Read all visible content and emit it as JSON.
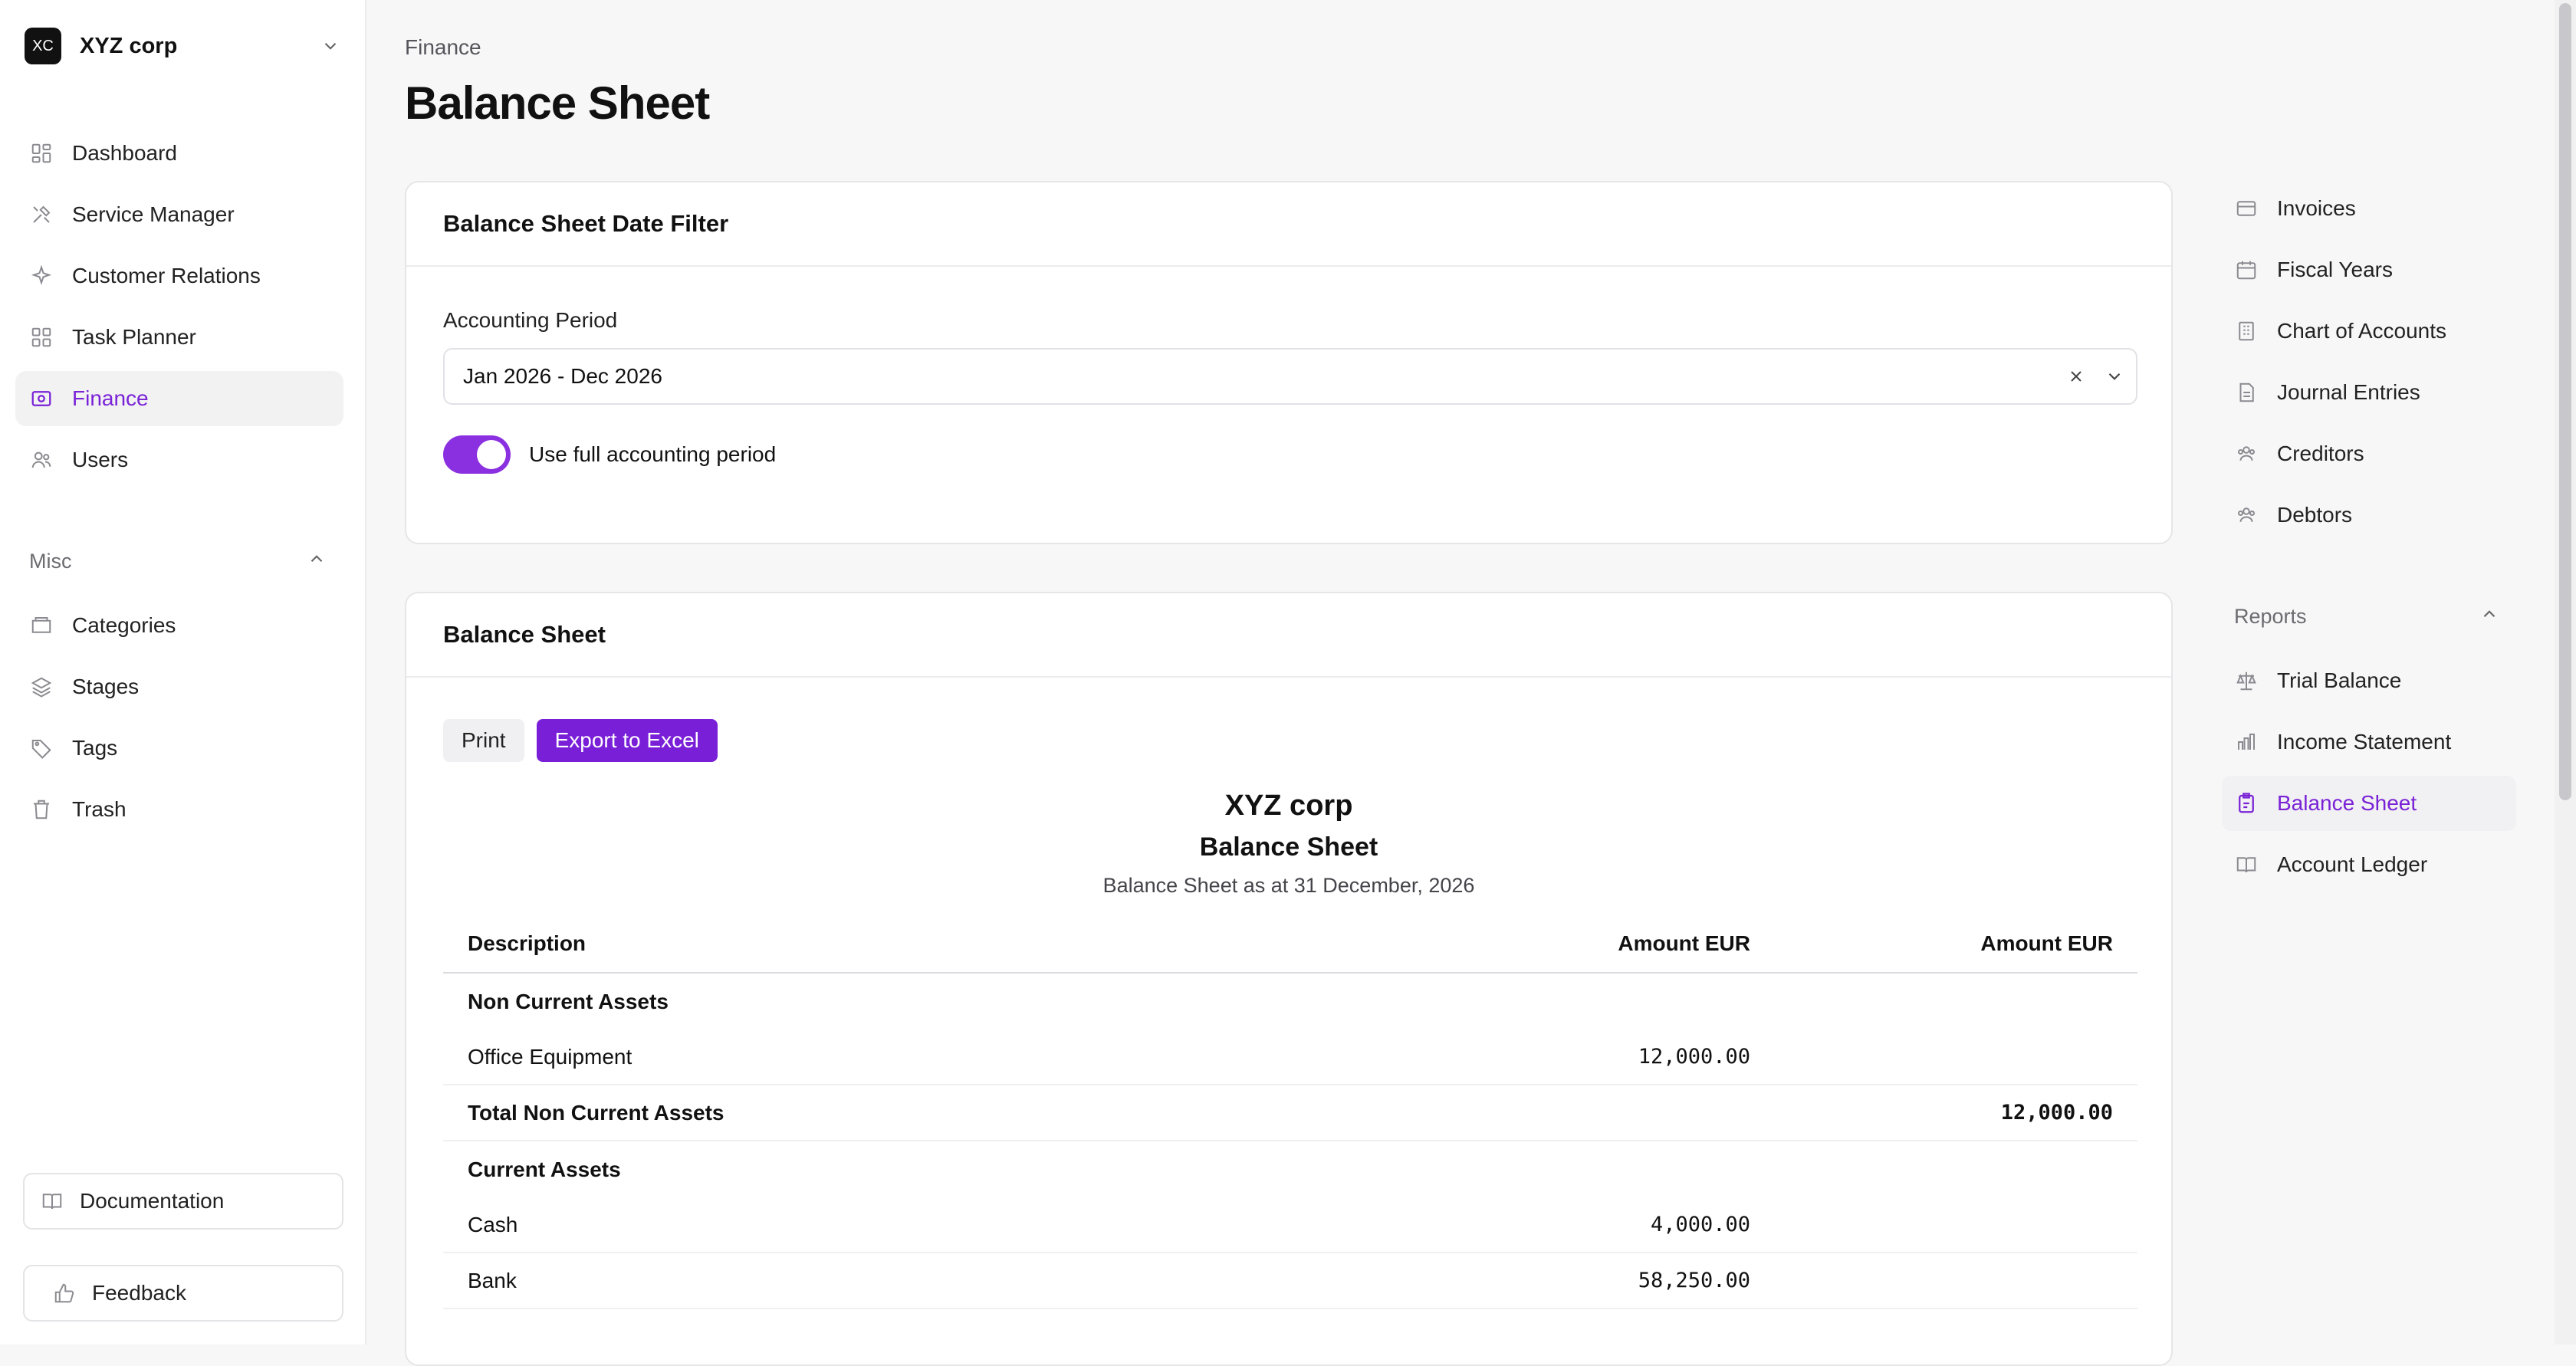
{
  "org": {
    "initials": "XC",
    "name": "XYZ corp"
  },
  "sidebar": {
    "main_items": [
      {
        "label": "Dashboard",
        "icon": "dashboard-icon"
      },
      {
        "label": "Service Manager",
        "icon": "tools-icon"
      },
      {
        "label": "Customer Relations",
        "icon": "sparkle-icon"
      },
      {
        "label": "Task Planner",
        "icon": "grid-icon"
      },
      {
        "label": "Finance",
        "icon": "finance-icon",
        "active": true
      },
      {
        "label": "Users",
        "icon": "users-icon"
      }
    ],
    "misc_heading": "Misc",
    "misc_items": [
      {
        "label": "Categories",
        "icon": "folder-icon"
      },
      {
        "label": "Stages",
        "icon": "layers-icon"
      },
      {
        "label": "Tags",
        "icon": "tag-icon"
      },
      {
        "label": "Trash",
        "icon": "trash-icon"
      }
    ],
    "documentation_label": "Documentation",
    "feedback_label": "Feedback"
  },
  "header": {
    "breadcrumb": "Finance",
    "title": "Balance Sheet"
  },
  "filter_card": {
    "title": "Balance Sheet Date Filter",
    "period_label": "Accounting Period",
    "period_value": "Jan 2026 - Dec 2026",
    "toggle_label": "Use full accounting period"
  },
  "report_card": {
    "title": "Balance Sheet",
    "print_label": "Print",
    "export_label": "Export to Excel",
    "company": "XYZ corp",
    "report_title": "Balance Sheet",
    "subtitle": "Balance Sheet as at 31 December, 2026",
    "columns": [
      "Description",
      "Amount EUR",
      "Amount EUR"
    ],
    "rows": [
      {
        "type": "group",
        "desc": "Non Current Assets",
        "amt1": "",
        "amt2": ""
      },
      {
        "type": "item",
        "desc": "Office Equipment",
        "amt1": "12,000.00",
        "amt2": ""
      },
      {
        "type": "total",
        "desc": "Total Non Current Assets",
        "amt1": "",
        "amt2": "12,000.00"
      },
      {
        "type": "group",
        "desc": "Current Assets",
        "amt1": "",
        "amt2": ""
      },
      {
        "type": "item",
        "desc": "Cash",
        "amt1": "4,000.00",
        "amt2": ""
      },
      {
        "type": "item",
        "desc": "Bank",
        "amt1": "58,250.00",
        "amt2": ""
      }
    ]
  },
  "right_nav": {
    "items": [
      {
        "label": "Invoices",
        "icon": "invoice-icon"
      },
      {
        "label": "Fiscal Years",
        "icon": "calendar-icon"
      },
      {
        "label": "Chart of Accounts",
        "icon": "building-icon"
      },
      {
        "label": "Journal Entries",
        "icon": "document-icon"
      },
      {
        "label": "Creditors",
        "icon": "people-icon"
      },
      {
        "label": "Debtors",
        "icon": "people-icon"
      }
    ],
    "reports_heading": "Reports",
    "report_items": [
      {
        "label": "Trial Balance",
        "icon": "scale-icon"
      },
      {
        "label": "Income Statement",
        "icon": "bar-chart-icon"
      },
      {
        "label": "Balance Sheet",
        "icon": "balance-sheet-icon",
        "active": true
      },
      {
        "label": "Account Ledger",
        "icon": "book-icon"
      }
    ]
  },
  "colors": {
    "accent": "#7a1fd8",
    "active_bg": "#f2f2f3"
  }
}
